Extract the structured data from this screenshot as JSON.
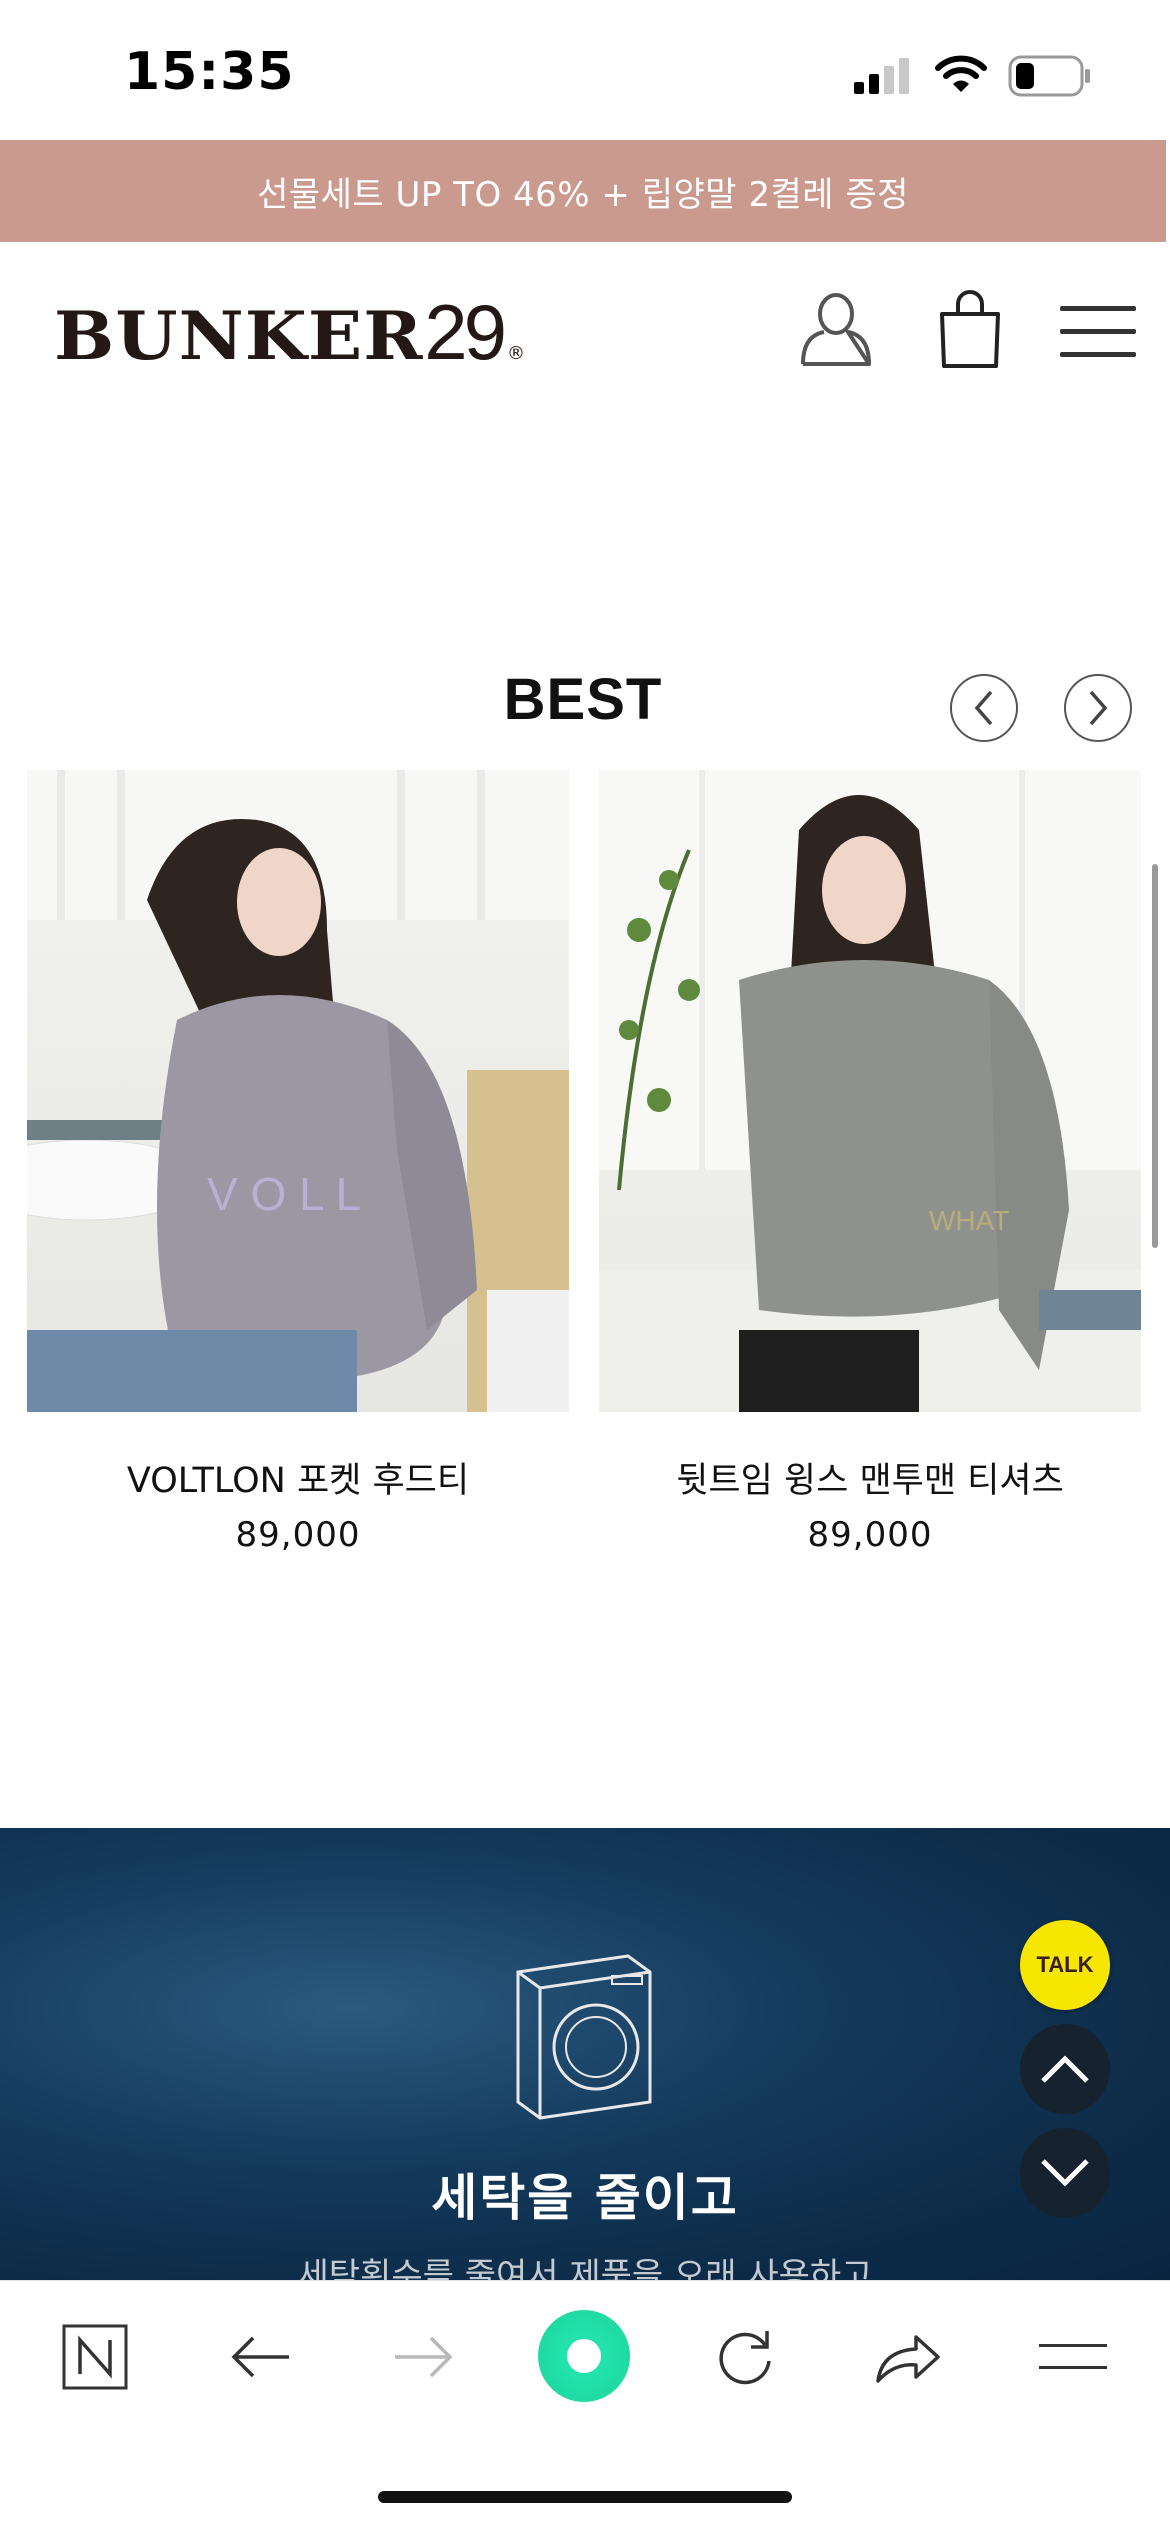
{
  "status_bar": {
    "time": "15:35"
  },
  "promo_banner": {
    "text": "선물세트 UP TO 46% + 립양말 2켤레 증정"
  },
  "header": {
    "logo_text": "BUNKER",
    "logo_number": "29",
    "logo_mark": "®"
  },
  "best_section": {
    "title": "BEST",
    "products": [
      {
        "name": "VOLTLON 포켓 후드티",
        "price": "89,000"
      },
      {
        "name": "뒷트임 윙스 맨투맨 티셔츠",
        "price": "89,000"
      }
    ]
  },
  "laundry_section": {
    "heading": "세탁을 줄이고",
    "subtext": "세탁횟수를 줄여서 제품을 오래 사용하고"
  },
  "floating": {
    "talk_label": "TALK"
  },
  "icons": {
    "account": "user-icon",
    "cart": "shopping-bag-icon",
    "menu": "hamburger-icon",
    "prev": "chevron-left-icon",
    "next": "chevron-right-icon",
    "scroll_up": "chevron-up-icon",
    "scroll_down": "chevron-down-icon",
    "washer": "washing-machine-icon"
  },
  "colors": {
    "promo_bg": "#c99a8d",
    "talk_bg": "#f7e600",
    "section_bg": "#0c2b48",
    "browser_accent": "#1ee3a0"
  }
}
